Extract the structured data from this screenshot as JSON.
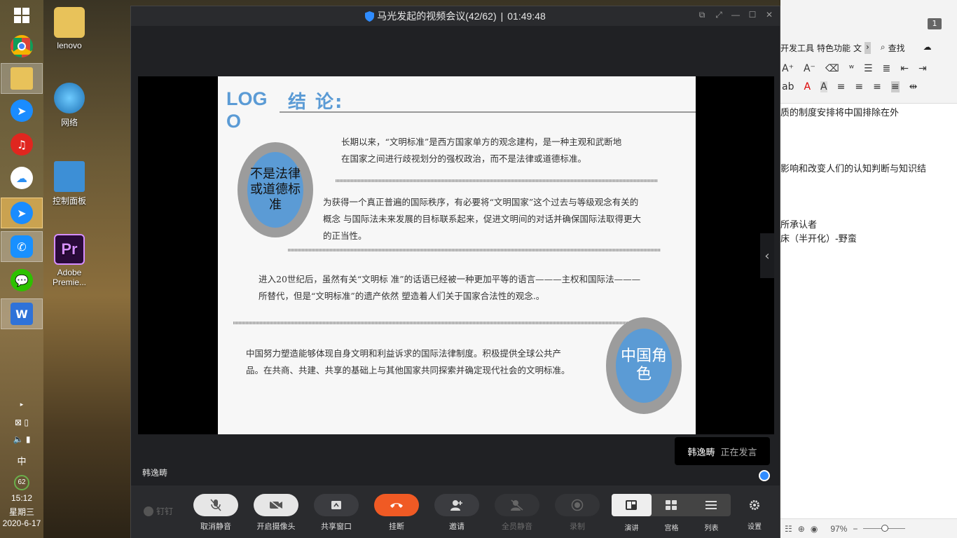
{
  "window": {
    "title": "马光发起的视频会议(42/62)",
    "elapsed": "01:49:48"
  },
  "desktop": {
    "icons": [
      {
        "label": "lenovo"
      },
      {
        "label": "网络"
      },
      {
        "label": "控制面板"
      },
      {
        "label": "Adobe Premie..."
      }
    ]
  },
  "taskbar": {
    "tray": {
      "ime": "中",
      "badge": "62",
      "time": "15:12",
      "weekday": "星期三",
      "date": "2020-6-17"
    }
  },
  "slide": {
    "logo": "LOGO",
    "heading": "结 论:",
    "circle1": "不是法律或道德标准",
    "para1": [
      "长期以来，“文明标准”是西方国家单方的观念建构，是一种主观和武断地",
      "在国家之间进行歧视划分的强权政治，而不是法律或道德标准。"
    ],
    "para2": [
      "为获得一个真正普遍的国际秩序，有必要将“文明国家”这个过去与等级观念有关的",
      "概念 与国际法未来发展的目标联系起来，促进文明间的对话并确保国际法取得更大",
      "的正当性。"
    ],
    "para3": [
      "进入20世纪后，虽然有关“文明标 准”的话语已经被一种更加平等的语言———主权和国际法———",
      "所替代，但是“文明标准”的遗产依然 塑造着人们关于国家合法性的观念.。"
    ],
    "para4": [
      "中国努力塑造能够体现自身文明和利益诉求的国际法律制度。积极提供全球公共产",
      "品。在共商、共建、共享的基础上与其他国家共同探索并确定现代社会的文明标准。"
    ],
    "circle2": "中国角色"
  },
  "speaker": {
    "name": "韩逸畴",
    "status": "正在发言"
  },
  "participant_label": "韩逸畴",
  "controls": {
    "dingtalk": "钉钉",
    "unmute": "取消静音",
    "camera": "开启摄像头",
    "share": "共享窗口",
    "hangup": "挂断",
    "invite": "邀请",
    "mute_all": "全员静音",
    "record": "录制",
    "view_speaker": "演讲",
    "view_grid": "宫格",
    "view_list": "列表",
    "settings": "设置"
  },
  "doc": {
    "page_badge": "1",
    "menu": [
      "开发工具",
      "特色功能",
      "文"
    ],
    "search": "查找",
    "lines": [
      "质的制度安排将中国排除在外",
      "影响和改变人们的认知判断与知识结",
      "所承认者",
      "床（半开化）-野蛮"
    ],
    "zoom": "97%"
  },
  "colors": {
    "hangup": "#f05a24",
    "slide_accent": "#5b9bd5",
    "circle_ring": "#9c9c9c"
  }
}
